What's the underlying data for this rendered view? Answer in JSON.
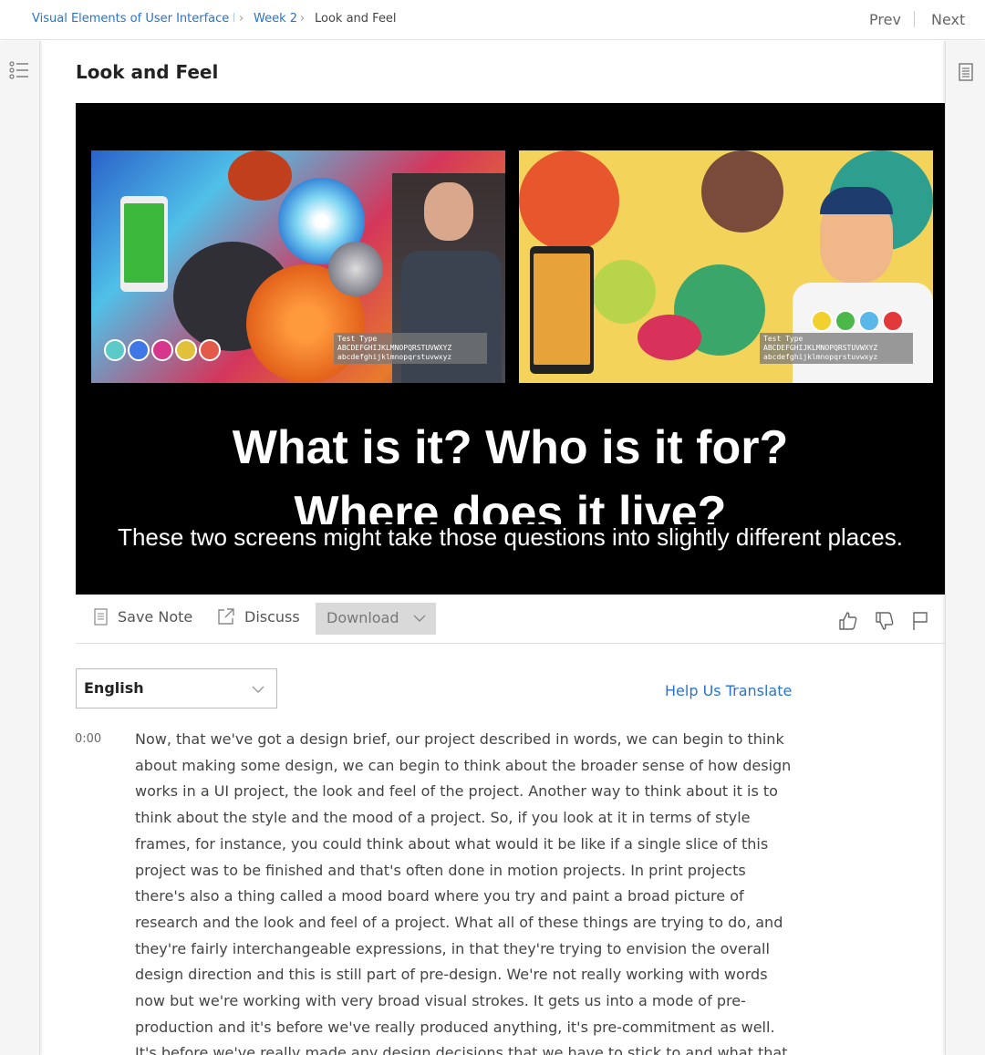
{
  "breadcrumb": {
    "course": "Visual Elements of User Interface De",
    "week": "Week 2",
    "current": "Look and Feel"
  },
  "nav": {
    "prev": "Prev",
    "next": "Next"
  },
  "page": {
    "title": "Look and Feel"
  },
  "video": {
    "type_card_left": [
      "Test Type",
      "ABCDEFGHIJKLMNOPQRSTUVWXYZ",
      "abcdefghijklmnopqrstuvwxyz"
    ],
    "type_card_right": [
      "Test Type",
      "ABCDEFGHIJKLMNOPQRSTUVWXYZ",
      "abcdefghijklmnopqrstuvwxyz"
    ],
    "overlay_line1": "What is it? Who is it for?",
    "overlay_line2": "Where does it live?",
    "caption": "These two screens might take those questions into slightly different places.",
    "swatch_colors_left": [
      "#5cc9c9",
      "#3f78e6",
      "#d6368c",
      "#e2c13a",
      "#e45a4a"
    ],
    "swatch_colors_right": [
      "#f2d02f",
      "#4cb84c",
      "#5ab8e8",
      "#e23a3a"
    ]
  },
  "toolbar": {
    "save_note": "Save Note",
    "discuss": "Discuss",
    "download": "Download"
  },
  "language": {
    "selected": "English",
    "help_translate": "Help Us Translate"
  },
  "transcript": {
    "timestamp": "0:00",
    "text": "Now, that we've got a design brief, our project described in words, we can begin to think about making some design, we can begin to think about the broader sense of how design works in a UI project, the look and feel of the project. Another way to think about it is to think about the style and the mood of a project. So, if you look at it in terms of style frames, for instance, you could think about what would it be like if a single slice of this project was to be finished and that's often done in motion projects. In print projects there's also a thing called a mood board where you try and paint a broad picture of research and the look and feel of a project. What all of these things are trying to do, and they're fairly interchangeable expressions, in that they're trying to envision the overall design direction and this is still part of pre-design. We're not really working with words now but we're working with very broad visual strokes. It gets us into a mode of pre-production and it's before we've really produced anything, it's pre-commitment as well. It's before we've really made any design decisions that we have to stick to and what that means is it's before you've really spent any money. You have to get all the components right before a project goes into production."
  },
  "colors": {
    "link": "#2a73cc",
    "download_bg": "#d9d9d9"
  }
}
